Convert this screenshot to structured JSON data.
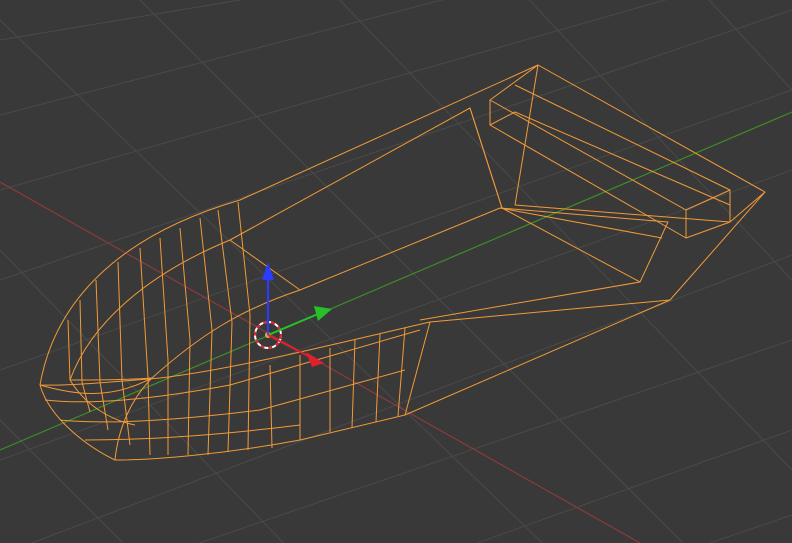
{
  "viewport": {
    "background_color": "#393939",
    "grid_color": "#4a4a4a",
    "x_axis_color": "#8c3a3a",
    "y_axis_color": "#3f8c2a",
    "selected_wire_color": "#f29a38"
  },
  "object": {
    "mode": "edit",
    "display": "wireframe",
    "selected": true
  },
  "gizmo": {
    "type": "translate",
    "x_arrow_color": "#e0202a",
    "y_arrow_color": "#27c02a",
    "z_arrow_color": "#2a3cff",
    "center_color": "#ffffff",
    "origin_dot_color": "#f2a33a"
  },
  "icons": [
    "3d-cursor-icon",
    "translate-gizmo-icon"
  ]
}
